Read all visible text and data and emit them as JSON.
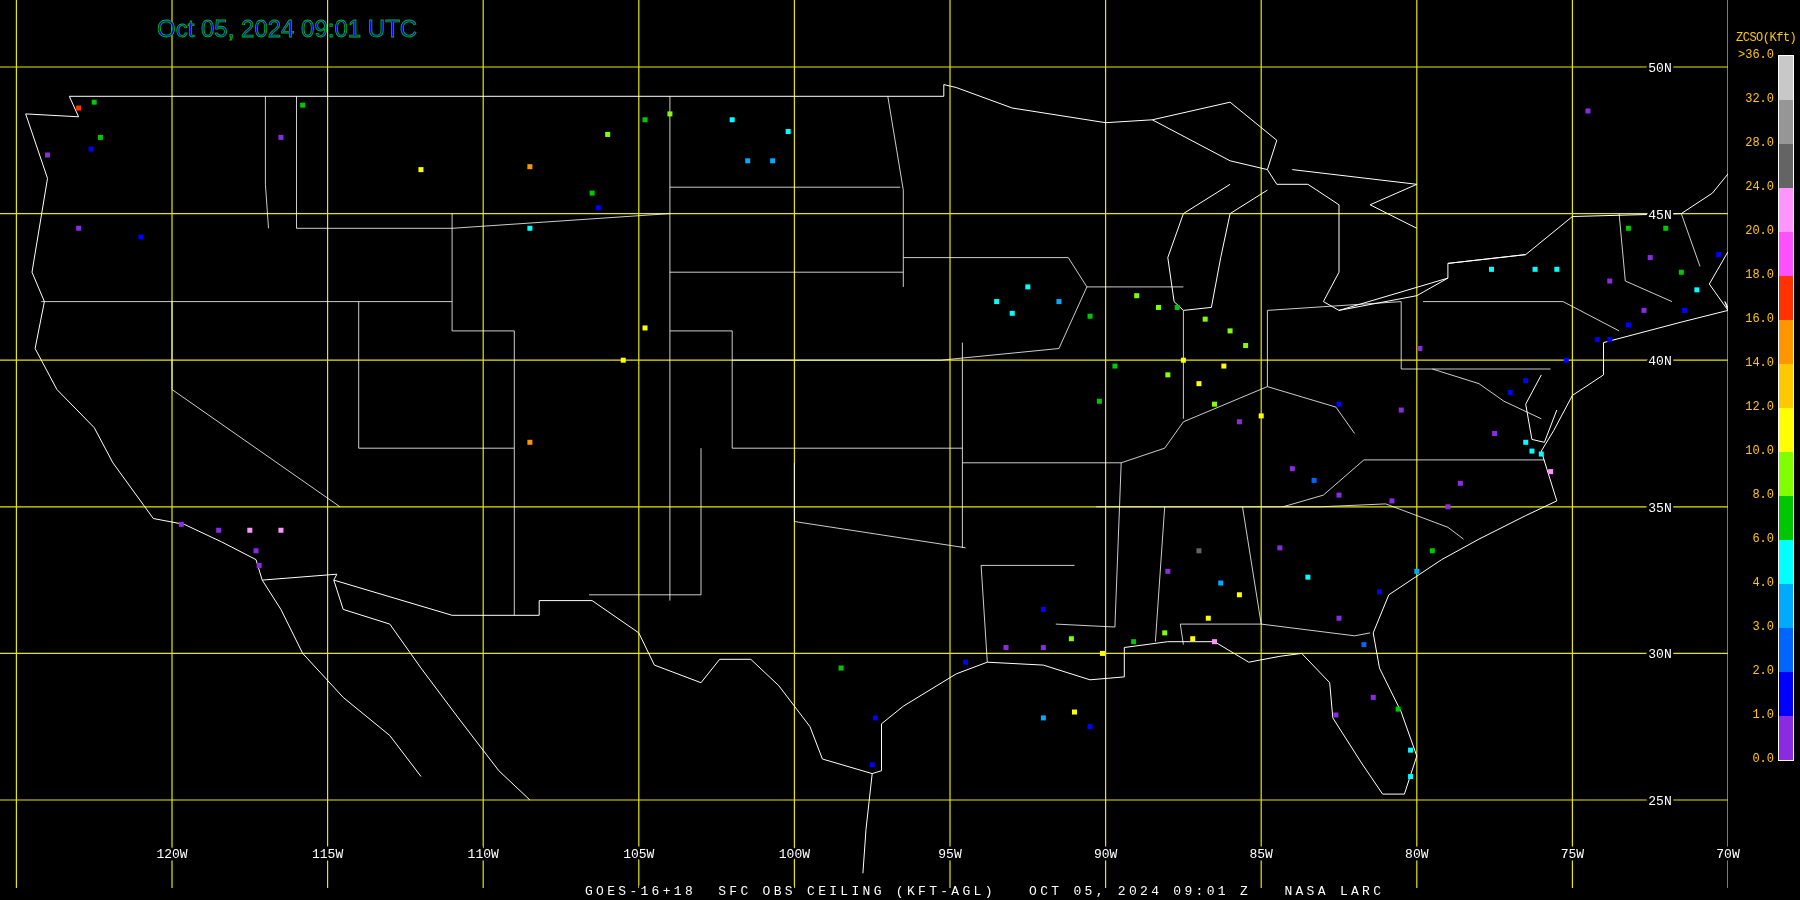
{
  "title": "Oct 05, 2024 09:01 UTC",
  "caption": "GOES-16+18  SFC OBS CEILING (KFT-AGL)   OCT 05, 2024 09:01 Z   NASA LARC",
  "longitude_labels": [
    "120W",
    "115W",
    "110W",
    "105W",
    "100W",
    "95W",
    "90W",
    "85W",
    "80W",
    "75W",
    "70W"
  ],
  "latitude_labels": [
    "50N",
    "45N",
    "40N",
    "35N",
    "30N",
    "25N"
  ],
  "legend": {
    "title": "ZCSO(Kft)",
    "ticks": [
      ">36.0",
      "32.0",
      "28.0",
      "24.0",
      "20.0",
      "18.0",
      "16.0",
      "14.0",
      "12.0",
      "10.0",
      "8.0",
      "6.0",
      "4.0",
      "3.0",
      "2.0",
      "1.0",
      "0.0"
    ],
    "bands": [
      {
        "color": "#c8c8c8"
      },
      {
        "color": "#969696"
      },
      {
        "color": "#646464"
      },
      {
        "color": "#ff96ff"
      },
      {
        "color": "#ff50ff"
      },
      {
        "color": "#ff3200"
      },
      {
        "color": "#ff9600"
      },
      {
        "color": "#ffc800"
      },
      {
        "color": "#ffff00"
      },
      {
        "color": "#80ff00"
      },
      {
        "color": "#00c800"
      },
      {
        "color": "#00ffff"
      },
      {
        "color": "#00aaff"
      },
      {
        "color": "#0064ff"
      },
      {
        "color": "#0000ff"
      },
      {
        "color": "#8a2be2"
      }
    ]
  }
}
